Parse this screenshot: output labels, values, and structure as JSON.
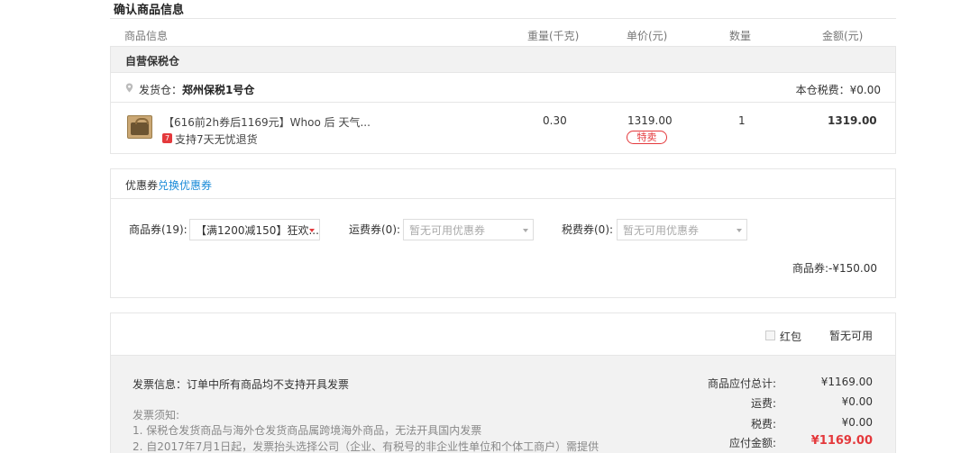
{
  "section_title": "确认商品信息",
  "columns": {
    "goods": "商品信息",
    "weight": "重量(千克)",
    "price": "单价(元)",
    "quantity": "数量",
    "amount": "金额(元)"
  },
  "warehouse": {
    "name": "自营保税仓",
    "ship_label": "发货仓：",
    "ship_value": "郑州保税1号仓",
    "tax_text": "本仓税费：¥0.00"
  },
  "product": {
    "title": "【616前2h券后1169元】Whoo 后 天气...",
    "return_icon": "7",
    "return_text": "支持7天无忧退货",
    "weight": "0.30",
    "price": "1319.00",
    "badge": "特卖",
    "quantity": "1",
    "amount": "1319.00"
  },
  "coupon": {
    "title": "优惠券",
    "link": "兑换优惠券",
    "goods_label": "商品券(19):",
    "goods_value": "【满1200减150】狂欢...",
    "shipping_label": "运费券(0):",
    "shipping_value": "暂无可用优惠券",
    "tax_label": "税费券(0):",
    "tax_value": "暂无可用优惠券",
    "discount_text": "商品券:-¥150.00"
  },
  "red_packet": {
    "label": "红包",
    "status": "暂无可用"
  },
  "summary": {
    "invoice": "发票信息：订单中所有商品均不支持开具发票",
    "notice_title": "发票须知:",
    "notice_lines": [
      "1. 保税仓发货商品与海外仓发货商品属跨境海外商品，无法开具国内发票",
      "2. 自2017年7月1日起，发票抬头选择公司（企业、有税号的非企业性单位和个体工商户）需提供"
    ],
    "rows": [
      {
        "label": "商品应付总计:",
        "value": "¥1169.00"
      },
      {
        "label": "运费:",
        "value": "¥0.00"
      },
      {
        "label": "税费:",
        "value": "¥0.00"
      },
      {
        "label": "应付金额:",
        "value": "¥1169.00"
      }
    ]
  },
  "colors": {
    "accent_red": "#e4393c",
    "link_blue": "#1a8bd8",
    "panel_gray": "#f2f2f2",
    "border": "#e6e6e6"
  }
}
